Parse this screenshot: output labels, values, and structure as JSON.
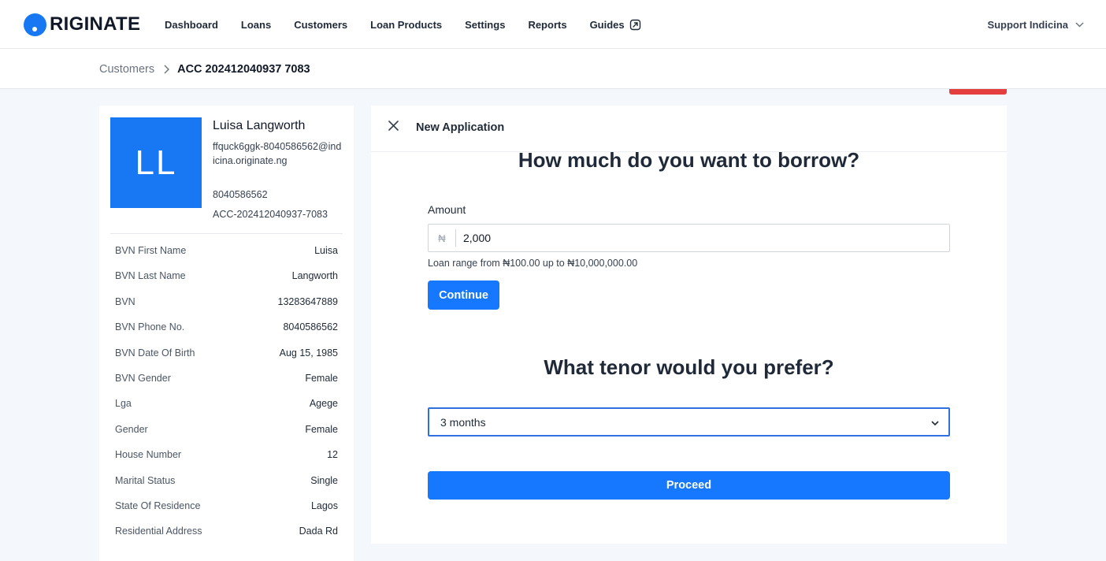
{
  "brand": {
    "logo_text": "RIGINATE",
    "accent_color": "#1877f2"
  },
  "nav": {
    "links": [
      {
        "label": "Dashboard"
      },
      {
        "label": "Loans"
      },
      {
        "label": "Customers"
      },
      {
        "label": "Loan Products"
      },
      {
        "label": "Settings"
      },
      {
        "label": "Reports"
      },
      {
        "label": "Guides",
        "icon": "external-link-icon"
      }
    ],
    "user_label": "Support Indicina"
  },
  "breadcrumb": {
    "parent": "Customers",
    "current": "ACC 202412040937 7083"
  },
  "profile": {
    "initials": "LL",
    "name": "Luisa Langworth",
    "email": "ffquck6ggk-8040586562@indicina.originate.ng",
    "phone": "8040586562",
    "account": "ACC-202412040937-7083"
  },
  "details": [
    {
      "label": "BVN First Name",
      "value": "Luisa"
    },
    {
      "label": "BVN Last Name",
      "value": "Langworth"
    },
    {
      "label": "BVN",
      "value": "13283647889"
    },
    {
      "label": "BVN Phone No.",
      "value": "8040586562"
    },
    {
      "label": "BVN Date Of Birth",
      "value": "Aug 15, 1985"
    },
    {
      "label": "BVN Gender",
      "value": "Female"
    },
    {
      "label": "Lga",
      "value": "Agege"
    },
    {
      "label": "Gender",
      "value": "Female"
    },
    {
      "label": "House Number",
      "value": "12"
    },
    {
      "label": "Marital Status",
      "value": "Single"
    },
    {
      "label": "State Of Residence",
      "value": "Lagos"
    },
    {
      "label": "Residential Address",
      "value": "Dada Rd"
    }
  ],
  "application": {
    "title": "New Application",
    "borrow_question": "How much do you want to borrow?",
    "amount_label": "Amount",
    "currency_symbol": "₦",
    "amount_value": "2,000",
    "range_hint": "Loan range from ₦100.00 up to ₦10,000,000.00",
    "continue_label": "Continue",
    "tenor_question": "What tenor would you prefer?",
    "tenor_selected": "3 months",
    "proceed_label": "Proceed"
  }
}
